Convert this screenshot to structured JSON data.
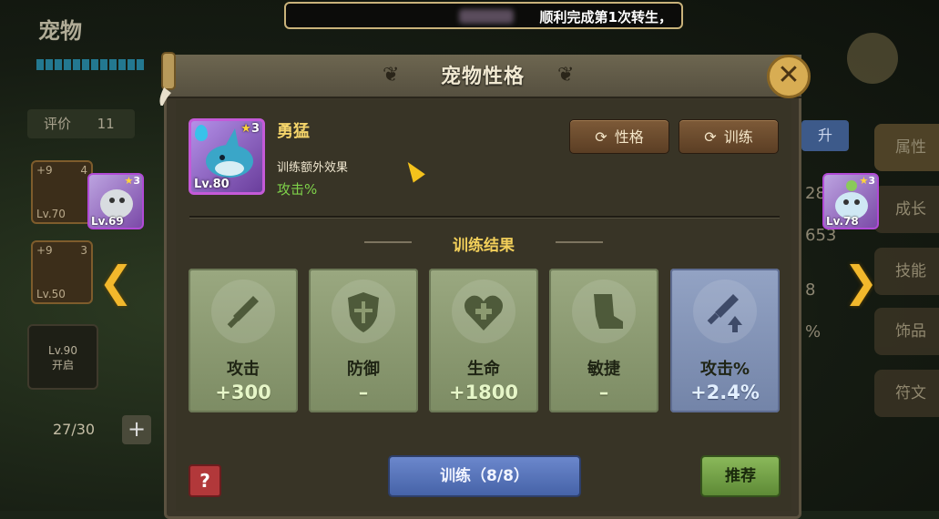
{
  "announcement": {
    "text": "顺利完成第1次转生，"
  },
  "background_left": {
    "title": "宠物",
    "rating_label": "评价",
    "rating_value": "11",
    "card1": {
      "plus": "+9",
      "stars": "4",
      "level": "Lv.70"
    },
    "card2": {
      "plus": "+9",
      "stars": "3",
      "level": "Lv.50"
    },
    "locked_card": {
      "level": "Lv.90",
      "status": "开启"
    },
    "count": "27/30",
    "add_label": "+"
  },
  "prev_pet": {
    "level": "Lv.69",
    "stars": "3"
  },
  "next_pet": {
    "level": "Lv.78",
    "stars": "3"
  },
  "right_tabs": [
    "属性",
    "成长",
    "技能",
    "饰品",
    "符文"
  ],
  "right_partial": {
    "partial_btn": "升",
    "num1": "28",
    "num2": "653",
    "num3": "8",
    "num4": "%"
  },
  "modal": {
    "title": "宠物性格",
    "close_label": "✕",
    "pet": {
      "name": "勇猛",
      "level": "Lv.80",
      "stars": "3"
    },
    "effect_label": "训练额外效果",
    "effect_value": "攻击%",
    "buttons": {
      "personality": "性格",
      "train": "训练"
    },
    "results_title": "训练结果",
    "results": [
      {
        "label": "攻击",
        "value": "+300",
        "icon": "sword-icon"
      },
      {
        "label": "防御",
        "value": "–",
        "icon": "shield-icon"
      },
      {
        "label": "生命",
        "value": "+1800",
        "icon": "heart-plus-icon"
      },
      {
        "label": "敏捷",
        "value": "–",
        "icon": "boot-icon"
      },
      {
        "label": "攻击%",
        "value": "+2.4%",
        "icon": "sword-up-icon",
        "highlight": true
      }
    ],
    "help_label": "?",
    "train_button": "训练（8/8）",
    "recommend_button": "推荐"
  },
  "colors": {
    "gold": "#f2cf5a",
    "green_card": "#8a9a6e",
    "blue_card": "#7f90b6",
    "train_blue": "#5674bc",
    "recommend_green": "#76a24a"
  }
}
